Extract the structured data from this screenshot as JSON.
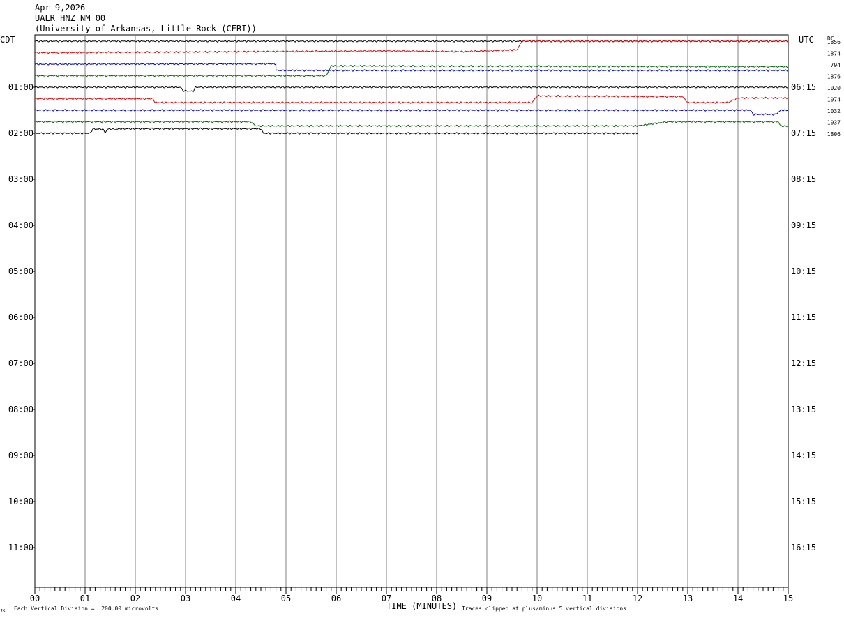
{
  "header": {
    "date": "Apr 9,2026",
    "station": "UALR HNZ NM 00",
    "network": "(University of Arkansas, Little Rock (CERI))"
  },
  "footer": {
    "corner_mark": "ᴊᴋ",
    "scale_note": "Each Vertical Division =  200.00 microvolts",
    "xlabel": "TIME (MINUTES)",
    "clip_note": "Traces clipped at plus/minus 5 vertical divisions"
  },
  "colors": {
    "black": "#000000",
    "red": "#e00000",
    "blue": "#0000d0",
    "green": "#006400",
    "grid": "#808080"
  },
  "chart_data": {
    "type": "line",
    "title": "UALR HNZ NM 00",
    "left_axis_label": "CDT",
    "right_axis_label": "UTC",
    "dc_label": "DC",
    "xlabel": "TIME (MINUTES)",
    "xlim": [
      0,
      15
    ],
    "x_ticks": [
      "00",
      "01",
      "02",
      "03",
      "04",
      "05",
      "06",
      "07",
      "08",
      "09",
      "10",
      "11",
      "12",
      "13",
      "14",
      "15"
    ],
    "rows_per_hour": 4,
    "y_ticks_cdt": [
      "01:00",
      "02:00",
      "03:00",
      "04:00",
      "05:00",
      "06:00",
      "07:00",
      "08:00",
      "09:00",
      "10:00",
      "11:00"
    ],
    "y_ticks_utc": [
      "06:15",
      "07:15",
      "08:15",
      "09:15",
      "10:15",
      "11:15",
      "12:15",
      "13:15",
      "14:15",
      "15:15",
      "16:15"
    ],
    "traces": [
      {
        "row": 0,
        "color": "black",
        "dc": "1856",
        "segments": [
          [
            0,
            0
          ],
          [
            9.6,
            0
          ],
          [
            15,
            0
          ]
        ],
        "end": 15
      },
      {
        "row": 1,
        "color": "red",
        "dc": "1874",
        "segments": [
          [
            0,
            0
          ],
          [
            4.6,
            -0.3
          ],
          [
            5.7,
            -0.4
          ],
          [
            7.0,
            -0.5
          ],
          [
            8.5,
            -0.3
          ],
          [
            9.6,
            -0.8
          ],
          [
            9.7,
            -3.3
          ],
          [
            15,
            -3.3
          ]
        ],
        "end": 15
      },
      {
        "row": 2,
        "color": "blue",
        "dc": "794",
        "segments": [
          [
            0,
            0
          ],
          [
            4.8,
            -0.1
          ],
          [
            4.8,
            1.8
          ],
          [
            5.0,
            1.8
          ],
          [
            15,
            1.8
          ]
        ],
        "end": 15
      },
      {
        "row": 3,
        "color": "green",
        "dc": "1876",
        "segments": [
          [
            0,
            0
          ],
          [
            5.8,
            0
          ],
          [
            5.9,
            -2.8
          ],
          [
            15,
            -2.6
          ]
        ],
        "end": 15
      },
      {
        "row": 4,
        "color": "black",
        "dc": "1020",
        "segments": [
          [
            0,
            0
          ],
          [
            2.9,
            0
          ],
          [
            2.95,
            1.0
          ],
          [
            3.15,
            1.2
          ],
          [
            3.2,
            0
          ],
          [
            15,
            0
          ]
        ],
        "end": 15
      },
      {
        "row": 5,
        "color": "red",
        "dc": "1074",
        "segments": [
          [
            0,
            0
          ],
          [
            2.35,
            0
          ],
          [
            2.4,
            1.1
          ],
          [
            5.0,
            1.1
          ],
          [
            9.9,
            1.1
          ],
          [
            10.0,
            -0.8
          ],
          [
            12.9,
            -0.6
          ],
          [
            13.0,
            1.1
          ],
          [
            13.8,
            1.1
          ],
          [
            14.0,
            -0.2
          ],
          [
            15,
            -0.2
          ]
        ],
        "end": 15
      },
      {
        "row": 6,
        "color": "blue",
        "dc": "1032",
        "segments": [
          [
            0,
            0
          ],
          [
            14.25,
            0
          ],
          [
            14.3,
            1.2
          ],
          [
            14.75,
            1.2
          ],
          [
            14.85,
            0
          ],
          [
            15,
            0
          ]
        ],
        "end": 15
      },
      {
        "row": 7,
        "color": "green",
        "dc": "1037",
        "segments": [
          [
            0,
            0
          ],
          [
            4.3,
            0
          ],
          [
            4.4,
            1.2
          ],
          [
            12.0,
            1.2
          ],
          [
            12.6,
            0
          ],
          [
            14.8,
            0
          ],
          [
            14.85,
            1.2
          ],
          [
            15,
            1.3
          ]
        ],
        "end": 15
      },
      {
        "row": 8,
        "color": "black",
        "dc": "1806",
        "segments": [
          [
            0,
            0
          ],
          [
            1.1,
            0
          ],
          [
            1.15,
            -1.2
          ],
          [
            1.35,
            -1.2
          ],
          [
            1.4,
            -0.2
          ],
          [
            1.45,
            -1.2
          ],
          [
            1.55,
            -1.2
          ],
          [
            1.6,
            -1.1
          ],
          [
            1.7,
            -1.3
          ],
          [
            4.5,
            -1.3
          ],
          [
            4.55,
            0
          ],
          [
            12.0,
            0
          ]
        ],
        "end": 12.0
      }
    ]
  }
}
